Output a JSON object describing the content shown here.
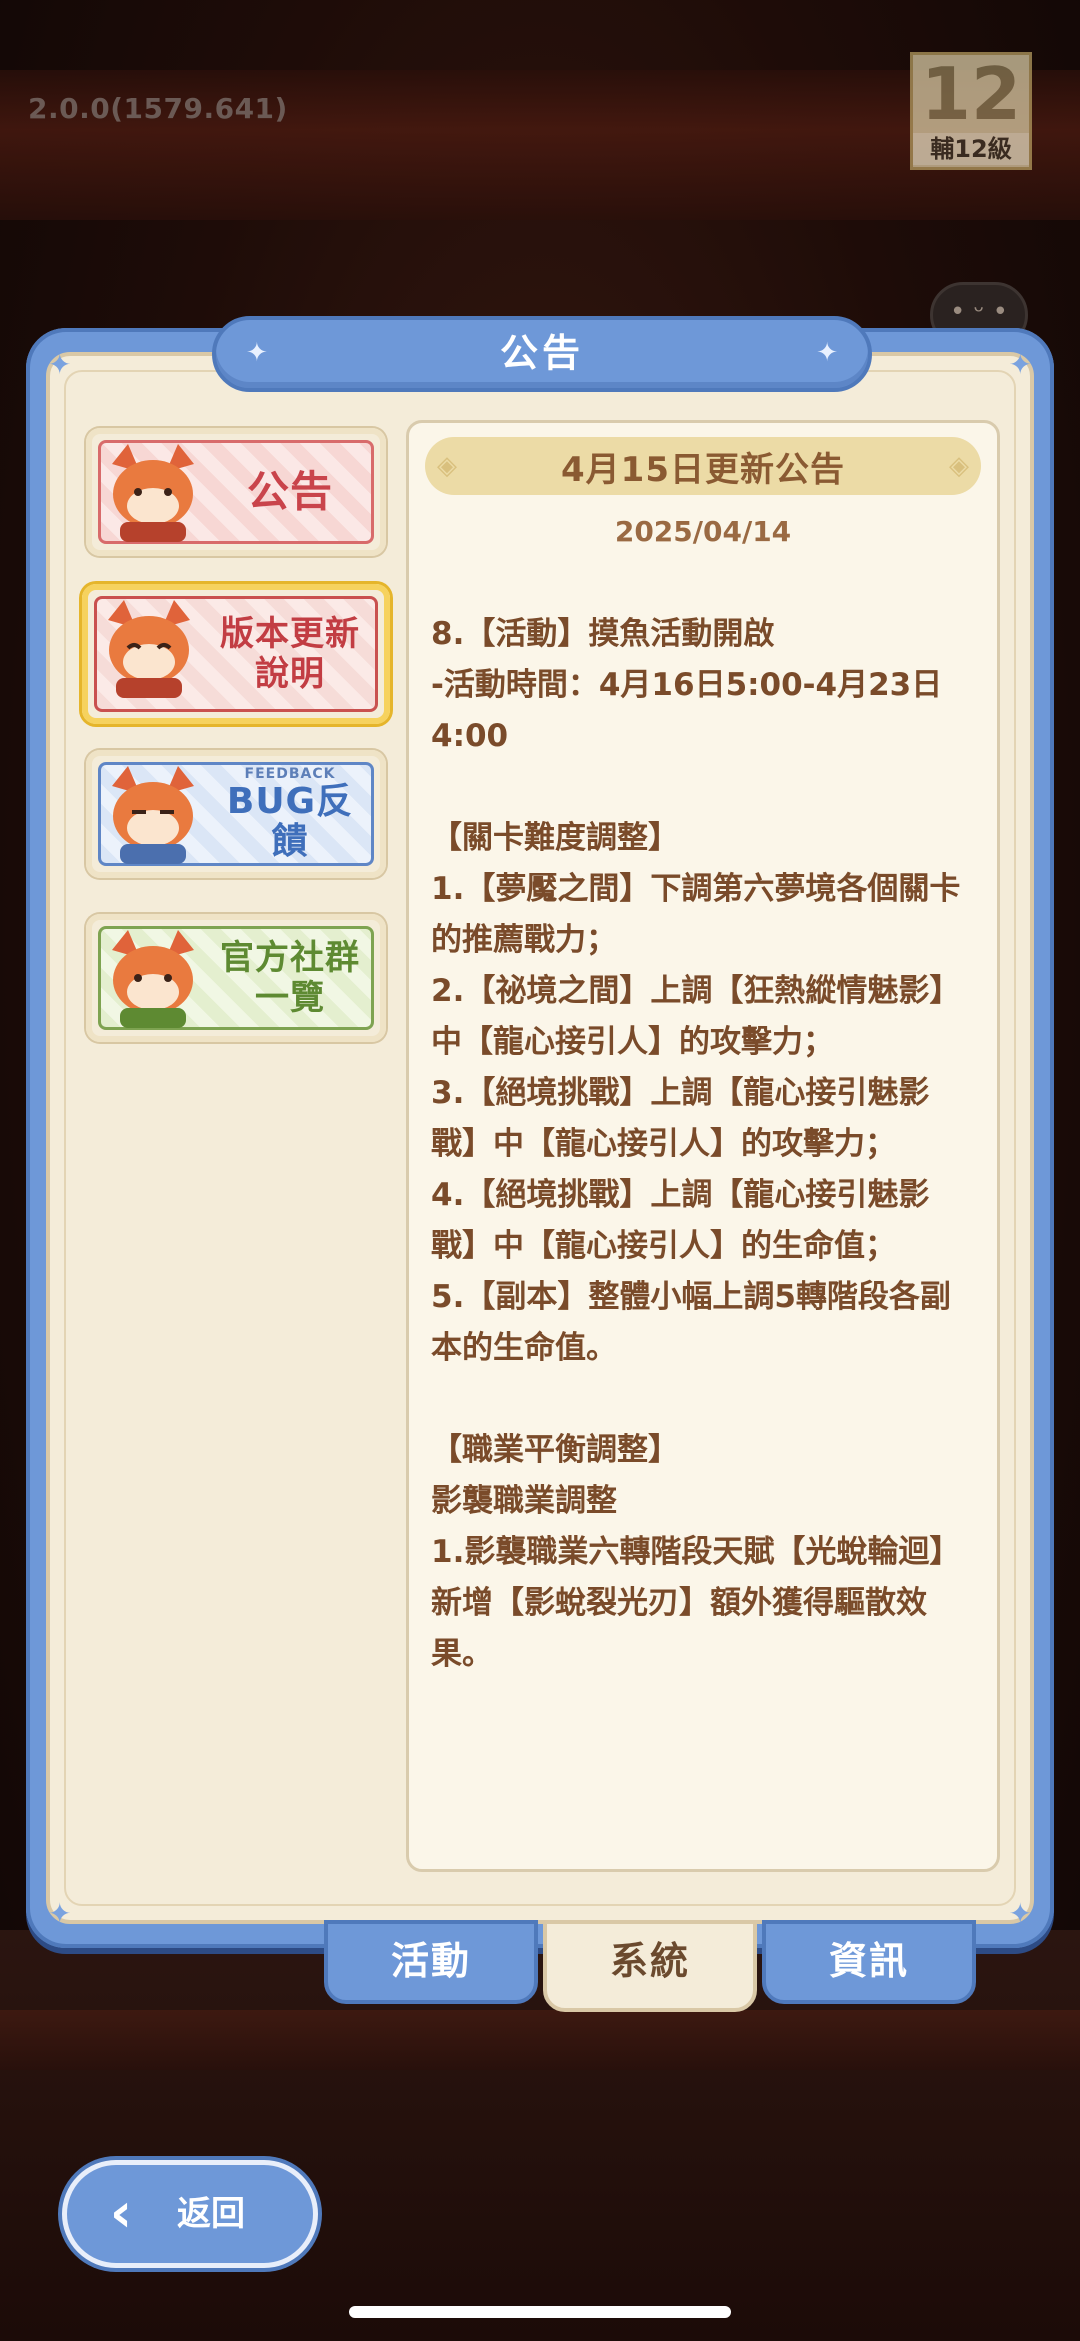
{
  "version": "2.0.0(1579.641)",
  "age_rating": {
    "number": "12",
    "label": "輔12級"
  },
  "panel": {
    "title": "公告"
  },
  "sidebar": {
    "items": [
      {
        "label": "公告"
      },
      {
        "label": "版本更新\n說明"
      },
      {
        "label": "BUG反饋",
        "sub": "FEEDBACK"
      },
      {
        "label": "官方社群\n一覽"
      }
    ]
  },
  "content": {
    "title": "4月15日更新公告",
    "date": "2025/04/14",
    "body": "8.【活動】摸魚活動開啟\n-活動時間：4月16日5:00-4月23日4:00\n\n【關卡難度調整】\n1.【夢魘之間】下調第六夢境各個關卡的推薦戰力；\n2.【祕境之間】上調【狂熱縱情魅影】中【龍心接引人】的攻擊力；\n3.【絕境挑戰】上調【龍心接引魅影戰】中【龍心接引人】的攻擊力；\n4.【絕境挑戰】上調【龍心接引魅影戰】中【龍心接引人】的生命值；\n5.【副本】整體小幅上調5轉階段各副本的生命值。\n\n【職業平衡調整】\n影襲職業調整\n1.影襲職業六轉階段天賦【光蛻輪迴】新增【影蛻裂光刃】額外獲得驅散效果。"
  },
  "tabs": [
    {
      "label": "活動"
    },
    {
      "label": "系統"
    },
    {
      "label": "資訊"
    }
  ],
  "back_button": {
    "label": "返回"
  },
  "colors": {
    "panel_blue": "#6e98d8",
    "parchment": "#f4ecd9",
    "text_brown": "#7a4b2a"
  }
}
